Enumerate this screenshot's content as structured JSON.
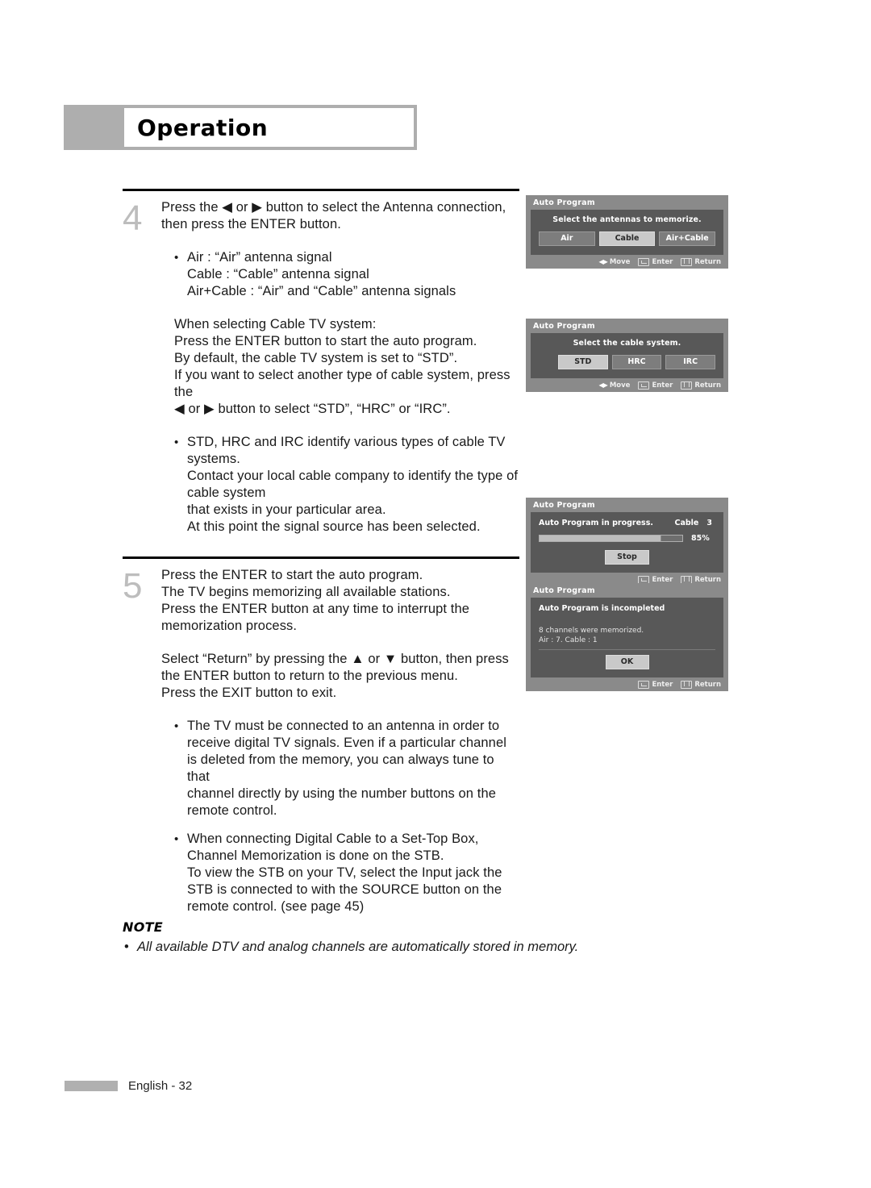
{
  "header": {
    "title": "Operation"
  },
  "steps": [
    {
      "number": "4",
      "lines": "Press the ◀ or ▶ button to select the Antenna connection,\nthen press the ENTER button.",
      "bullets": [
        "Air : “Air” antenna signal\nCable : “Cable” antenna signal\nAir+Cable : “Air” and “Cable” antenna signals"
      ],
      "paragraph": "When selecting Cable TV system:\nPress the ENTER button to start the auto program.\nBy default, the cable TV system is set to “STD”.\nIf you want to select another type of cable system, press the\n◀ or ▶ button to select “STD”, “HRC” or “IRC”.",
      "bullets2": [
        "STD, HRC and IRC identify various types of cable TV systems.\nContact your local cable company to identify the type of cable system\nthat exists in your particular area.\nAt this point the signal source has been selected."
      ]
    },
    {
      "number": "5",
      "lines": "Press the ENTER to start the auto program.\nThe TV begins memorizing all available stations.\nPress the ENTER button at any time to interrupt the\nmemorization process.",
      "paragraph": "Select “Return” by pressing the ▲ or ▼ button, then press\nthe ENTER button to return to the previous menu.\nPress the EXIT button to exit.",
      "bullets2": [
        "The TV must be connected to an antenna in order to\nreceive digital TV signals. Even if a particular channel\nis deleted from the memory, you can always tune to that\nchannel directly by using the number buttons on the\nremote control.",
        "When connecting Digital Cable to a Set-Top Box,\nChannel Memorization is done on the STB.\nTo view the STB on your TV, select the Input jack the\nSTB is connected to with the SOURCE button on the\nremote control. (see page 45)"
      ]
    }
  ],
  "note": {
    "label": "NOTE",
    "text": "All available DTV and analog channels are automatically stored in memory."
  },
  "footer": {
    "text": "English - 32"
  },
  "osd": {
    "antenna": {
      "title": "Auto Program",
      "message": "Select the antennas to memorize.",
      "buttons": [
        {
          "label": "Air",
          "selected": false
        },
        {
          "label": "Cable",
          "selected": true
        },
        {
          "label": "Air+Cable",
          "selected": false
        }
      ],
      "foot": {
        "move": "Move",
        "enter": "Enter",
        "return": "Return"
      }
    },
    "cable_system": {
      "title": "Auto Program",
      "message": "Select the cable system.",
      "buttons": [
        {
          "label": "STD",
          "selected": true
        },
        {
          "label": "HRC",
          "selected": false
        },
        {
          "label": "IRC",
          "selected": false
        }
      ],
      "foot": {
        "move": "Move",
        "enter": "Enter",
        "return": "Return"
      }
    },
    "progress": {
      "title": "Auto Program",
      "status": "Auto Program in progress.",
      "source": "Cable",
      "channel": "3",
      "percent_label": "85%",
      "percent_value": 85,
      "stop_label": "Stop",
      "foot": {
        "enter": "Enter",
        "return": "Return"
      }
    },
    "incomplete": {
      "title": "Auto Program",
      "heading": "Auto Program is incompleted",
      "line1": "8 channels were memorized.",
      "line2": "Air : 7. Cable : 1",
      "ok_label": "OK",
      "foot": {
        "enter": "Enter",
        "return": "Return"
      }
    }
  }
}
